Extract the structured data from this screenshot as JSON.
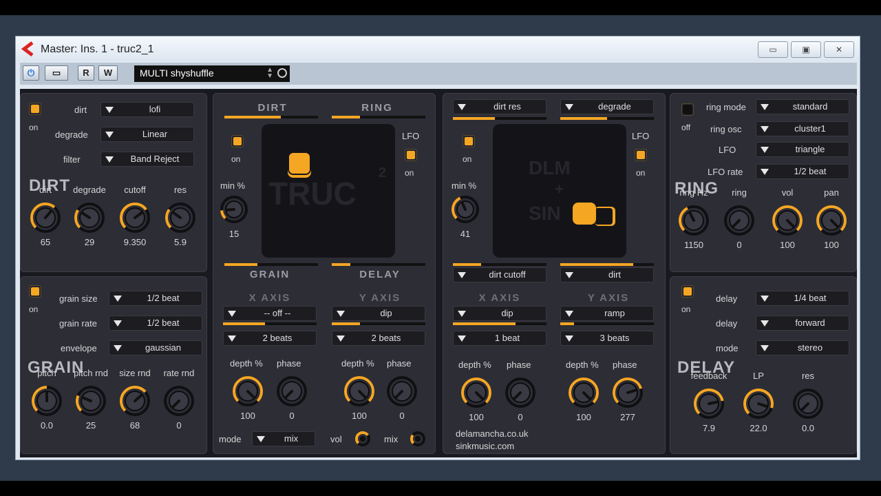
{
  "window": {
    "title": "Master: Ins. 1 - truc2_1",
    "minimize": "▭",
    "restore": "▣",
    "close": "✕"
  },
  "toolbar": {
    "power": "⏻",
    "compare": "▭",
    "read": "R",
    "write": "W",
    "preset": "MULTI shyshuffle"
  },
  "accent": "#f5a623",
  "dirt": {
    "toggle": "on",
    "labels": {
      "dirt": "dirt",
      "degrade": "degrade",
      "filter": "filter"
    },
    "values": {
      "dirt": "lofi",
      "degrade": "Linear",
      "filter": "Band Reject"
    },
    "title": "DIRT",
    "knobs": [
      {
        "label": "dirt",
        "value": "65",
        "level": 0.65
      },
      {
        "label": "degrade",
        "value": "29",
        "level": 0.29
      },
      {
        "label": "cutoff",
        "value": "9.350",
        "level": 0.7
      },
      {
        "label": "res",
        "value": "5.9",
        "level": 0.3
      }
    ]
  },
  "grain": {
    "toggle": "on",
    "labels": {
      "size": "grain size",
      "rate": "grain rate",
      "env": "envelope"
    },
    "values": {
      "size": "1/2 beat",
      "rate": "1/2 beat",
      "env": "gaussian"
    },
    "title": "GRAIN",
    "knobs": [
      {
        "label": "pitch",
        "value": "0.0",
        "level": 0.5
      },
      {
        "label": "pitch rnd",
        "value": "25",
        "level": 0.25
      },
      {
        "label": "size rnd",
        "value": "68",
        "level": 0.68
      },
      {
        "label": "rate rnd",
        "value": "0",
        "level": 0
      }
    ]
  },
  "xy1": {
    "top_left": "DIRT",
    "top_right": "RING",
    "bot_left": "GRAIN",
    "bot_right": "DELAY",
    "on": "on",
    "lfo": "LFO",
    "lfo_on": "on",
    "min": "min %",
    "min_val": "15",
    "logo": "TRUC",
    "logo_sup": "2",
    "xaxis": "X AXIS",
    "yaxis": "Y AXIS",
    "x_sel": "-- off --",
    "x_beats": "2 beats",
    "y_sel": "dip",
    "y_beats": "2 beats",
    "depth": "depth %",
    "phase": "phase",
    "knobs": [
      {
        "value": "100",
        "level": 1
      },
      {
        "value": "0",
        "level": 0
      },
      {
        "value": "100",
        "level": 1
      },
      {
        "value": "0",
        "level": 0
      }
    ],
    "mode": "mode",
    "mode_val": "mix",
    "vol": "vol",
    "mix": "mix"
  },
  "xy2": {
    "top_left": "dirt res",
    "top_right": "degrade",
    "bot_left": "dirt cutoff",
    "bot_right": "dirt",
    "on": "on",
    "lfo": "LFO",
    "lfo_on": "on",
    "min": "min %",
    "min_val": "41",
    "logo1": "DLM",
    "logo2": "+",
    "logo3": "SIN",
    "xaxis": "X AXIS",
    "yaxis": "Y AXIS",
    "x_sel": "dip",
    "x_beats": "1 beat",
    "y_sel": "ramp",
    "y_beats": "3 beats",
    "depth": "depth %",
    "phase": "phase",
    "knobs": [
      {
        "value": "100",
        "level": 1
      },
      {
        "value": "0",
        "level": 0
      },
      {
        "value": "100",
        "level": 1
      },
      {
        "value": "277",
        "level": 0.77
      }
    ],
    "credit1": "delamancha.co.uk",
    "credit2": "sinkmusic.com"
  },
  "ring": {
    "toggle": "off",
    "labels": {
      "mode": "ring mode",
      "osc": "ring osc",
      "lfo": "LFO",
      "rate": "LFO rate"
    },
    "values": {
      "mode": "standard",
      "osc": "cluster1",
      "lfo": "triangle",
      "rate": "1/2 beat"
    },
    "title": "RING",
    "knobs": [
      {
        "label": "ring Hz",
        "value": "1150",
        "level": 0.4
      },
      {
        "label": "ring",
        "value": "0",
        "level": 0
      },
      {
        "label": "vol",
        "value": "100",
        "level": 1
      },
      {
        "label": "pan",
        "value": "100",
        "level": 1
      }
    ]
  },
  "delay": {
    "toggle": "on",
    "labels": {
      "d1": "delay",
      "d2": "delay",
      "mode": "mode"
    },
    "values": {
      "d1": "1/4 beat",
      "d2": "forward",
      "mode": "stereo"
    },
    "title": "DELAY",
    "knobs": [
      {
        "label": "feedback",
        "value": "7.9",
        "level": 0.79
      },
      {
        "label": "LP",
        "value": "22.0",
        "level": 0.9
      },
      {
        "label": "res",
        "value": "0.0",
        "level": 0
      }
    ]
  }
}
